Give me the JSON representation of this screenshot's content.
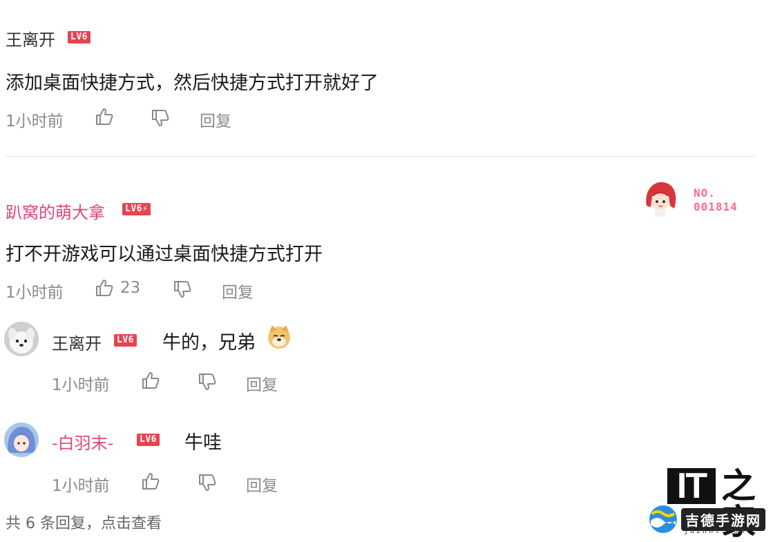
{
  "comment1": {
    "user": "王离开",
    "level": "LV6",
    "text": "添加桌面快捷方式，然后快捷方式打开就好了",
    "time": "1小时前",
    "reply_label": "回复"
  },
  "comment2": {
    "user": "趴窝的萌大拿",
    "level": "LV6⚡",
    "text": "打不开游戏可以通过桌面快捷方式打开",
    "time": "1小时前",
    "likes": "23",
    "reply_label": "回复",
    "badge": {
      "line1": "NO.",
      "line2": "001814"
    }
  },
  "replies": [
    {
      "user": "王离开",
      "level": "LV6",
      "text": "牛的，兄弟",
      "emoji": "doge-emoji",
      "time": "1小时前",
      "reply_label": "回复"
    },
    {
      "user": "-白羽末-",
      "level": "LV6",
      "text": "牛哇",
      "time": "1小时前",
      "reply_label": "回复"
    }
  ],
  "view_more": "共 6 条回复，点击查看",
  "watermark": {
    "it": "IT",
    "home": "之家",
    "site": "吉德手游网",
    "url": "jdzhnl.com"
  },
  "colors": {
    "level_badge": "#e8424f",
    "pink_name": "#e0457b",
    "badge_number": "#ff6a88"
  }
}
